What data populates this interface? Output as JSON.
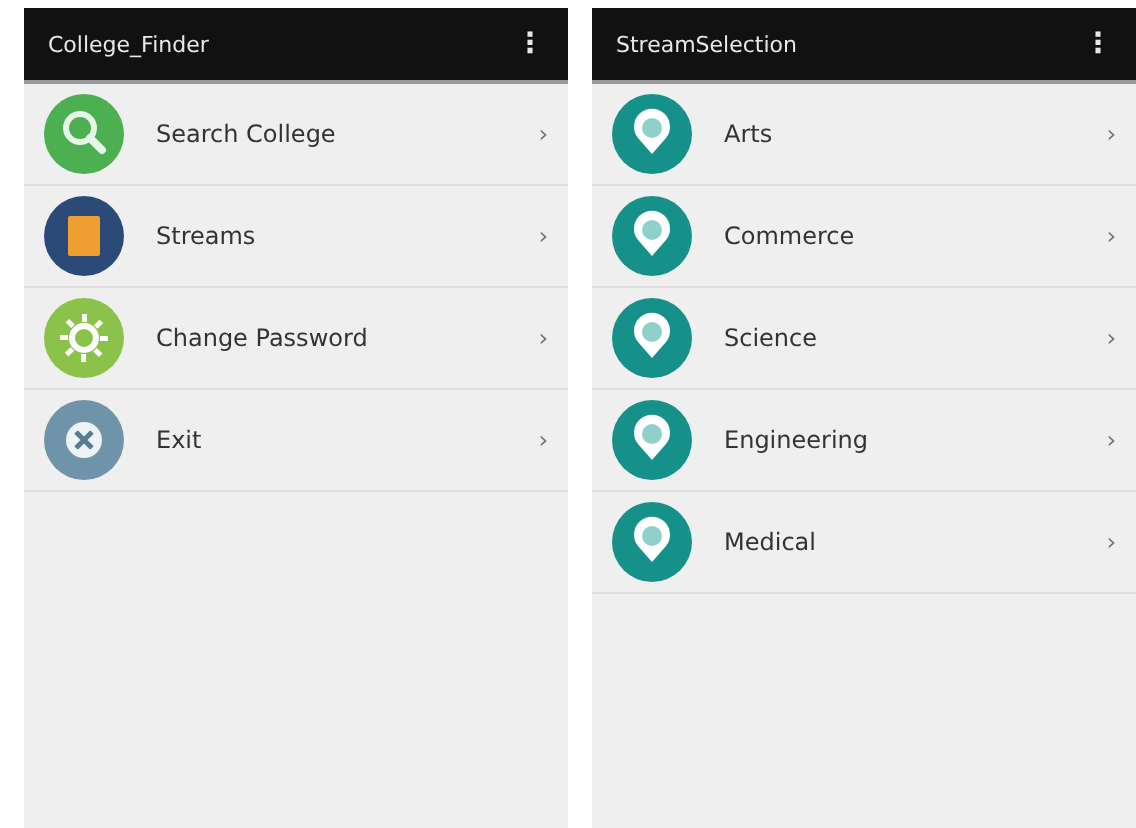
{
  "screens": [
    {
      "title": "College_Finder",
      "menu": "⋮",
      "items": [
        {
          "label": "Search College",
          "kind": "search",
          "color": "#4caf50",
          "chevron": "›"
        },
        {
          "label": "Streams",
          "kind": "book",
          "color": "#2c4a78",
          "chevron": "›"
        },
        {
          "label": "Change Password",
          "kind": "gear",
          "color": "#8bc34a",
          "chevron": "›"
        },
        {
          "label": "Exit",
          "kind": "close",
          "color": "#6f93a8",
          "chevron": "›"
        }
      ]
    },
    {
      "title": "StreamSelection",
      "menu": "⋮",
      "items": [
        {
          "label": "Arts",
          "kind": "pin",
          "color": "#16918a",
          "chevron": "›"
        },
        {
          "label": "Commerce",
          "kind": "pin",
          "color": "#16918a",
          "chevron": "›"
        },
        {
          "label": "Science",
          "kind": "pin",
          "color": "#16918a",
          "chevron": "›"
        },
        {
          "label": "Engineering",
          "kind": "pin",
          "color": "#16918a",
          "chevron": "›"
        },
        {
          "label": "Medical",
          "kind": "pin",
          "color": "#16918a",
          "chevron": "›"
        }
      ]
    }
  ]
}
